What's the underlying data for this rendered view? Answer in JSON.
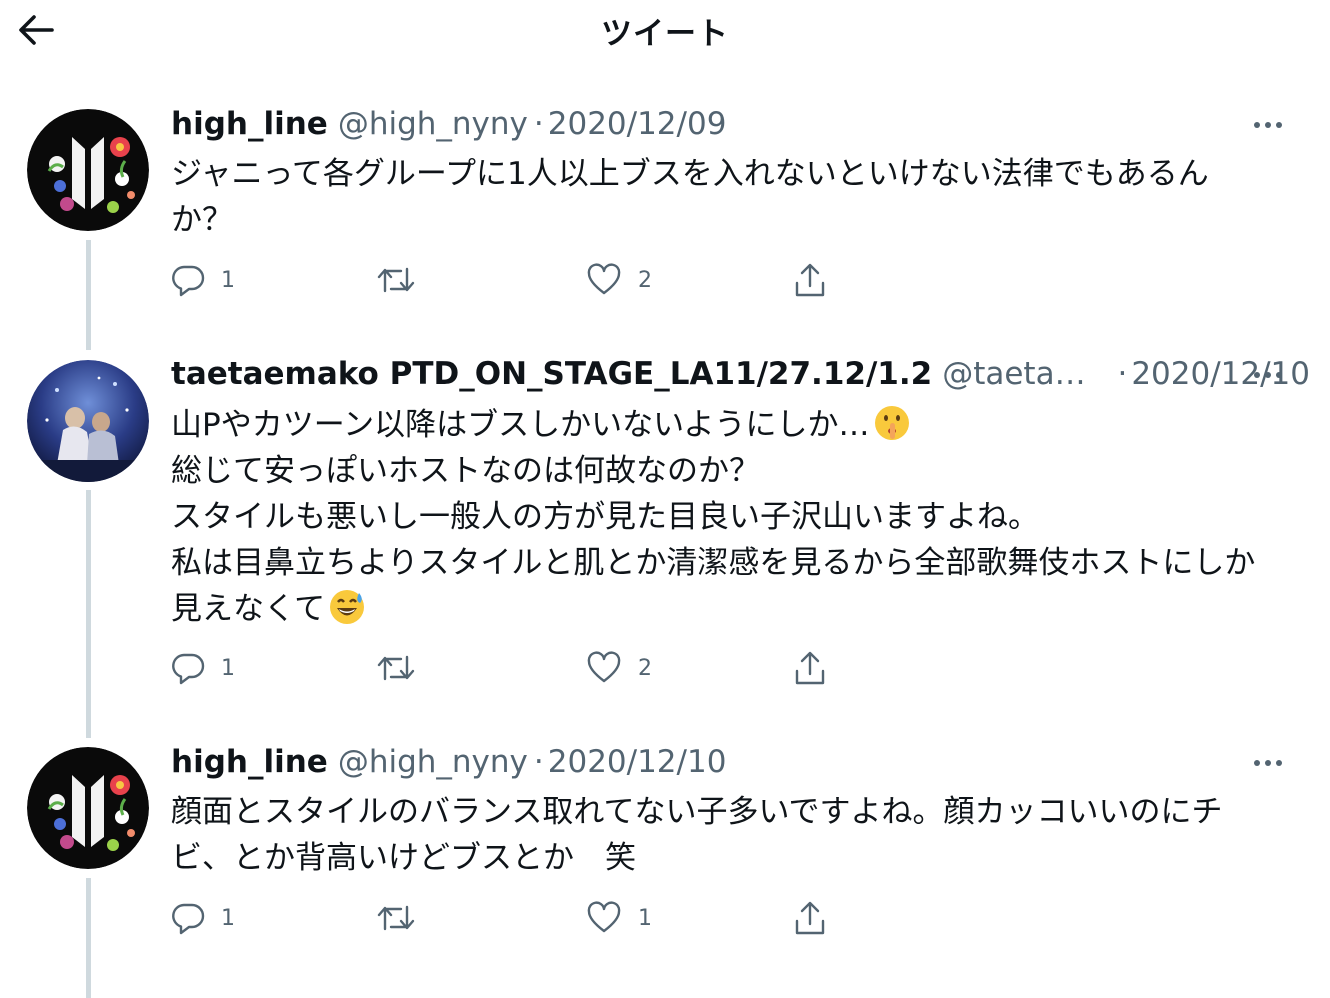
{
  "header": {
    "title": "ツイート",
    "back_icon": "arrow-left-icon"
  },
  "colors": {
    "text": "#0f1419",
    "secondary": "#536471",
    "thread_line": "#cfd9de"
  },
  "tweets": [
    {
      "display_name": "high_line",
      "handle": "@high_nyny",
      "sep": "·",
      "date": "2020/12/09",
      "lines": [
        "ジャニって各グループに1人以上ブスを入れないといけない法律でもあるん",
        "か？"
      ],
      "replies": "1",
      "retweets": "",
      "likes": "2"
    },
    {
      "display_name": "taetaemako PTD_ON_STAGE_LA11/27.12/1.2",
      "handle": "@taetaemako_",
      "sep": "·",
      "date": "2020/12/10",
      "lines": [
        "山Pやカツーン以降はブスしかいないようにしか…",
        "総じて安っぽいホストなのは何故なのか？",
        "スタイルも悪いし一般人の方が見た目良い子沢山いますよね。",
        "私は目鼻立ちよりスタイルと肌とか清潔感を見るから全部歌舞伎ホストにしか",
        "見えなくて"
      ],
      "emojis": [
        "shushing-face-emoji",
        "grinning-sweat-emoji"
      ],
      "replies": "1",
      "retweets": "",
      "likes": "2"
    },
    {
      "display_name": "high_line",
      "handle": "@high_nyny",
      "sep": "·",
      "date": "2020/12/10",
      "lines": [
        "顔面とスタイルのバランス取れてない子多いですよね。顔カッコいいのにチ",
        "ビ、とか背高いけどブスとか　笑"
      ],
      "replies": "1",
      "retweets": "",
      "likes": "1"
    }
  ],
  "icons": {
    "reply": "reply-icon",
    "retweet": "retweet-icon",
    "like": "heart-icon",
    "share": "share-icon",
    "more": "more-icon"
  }
}
